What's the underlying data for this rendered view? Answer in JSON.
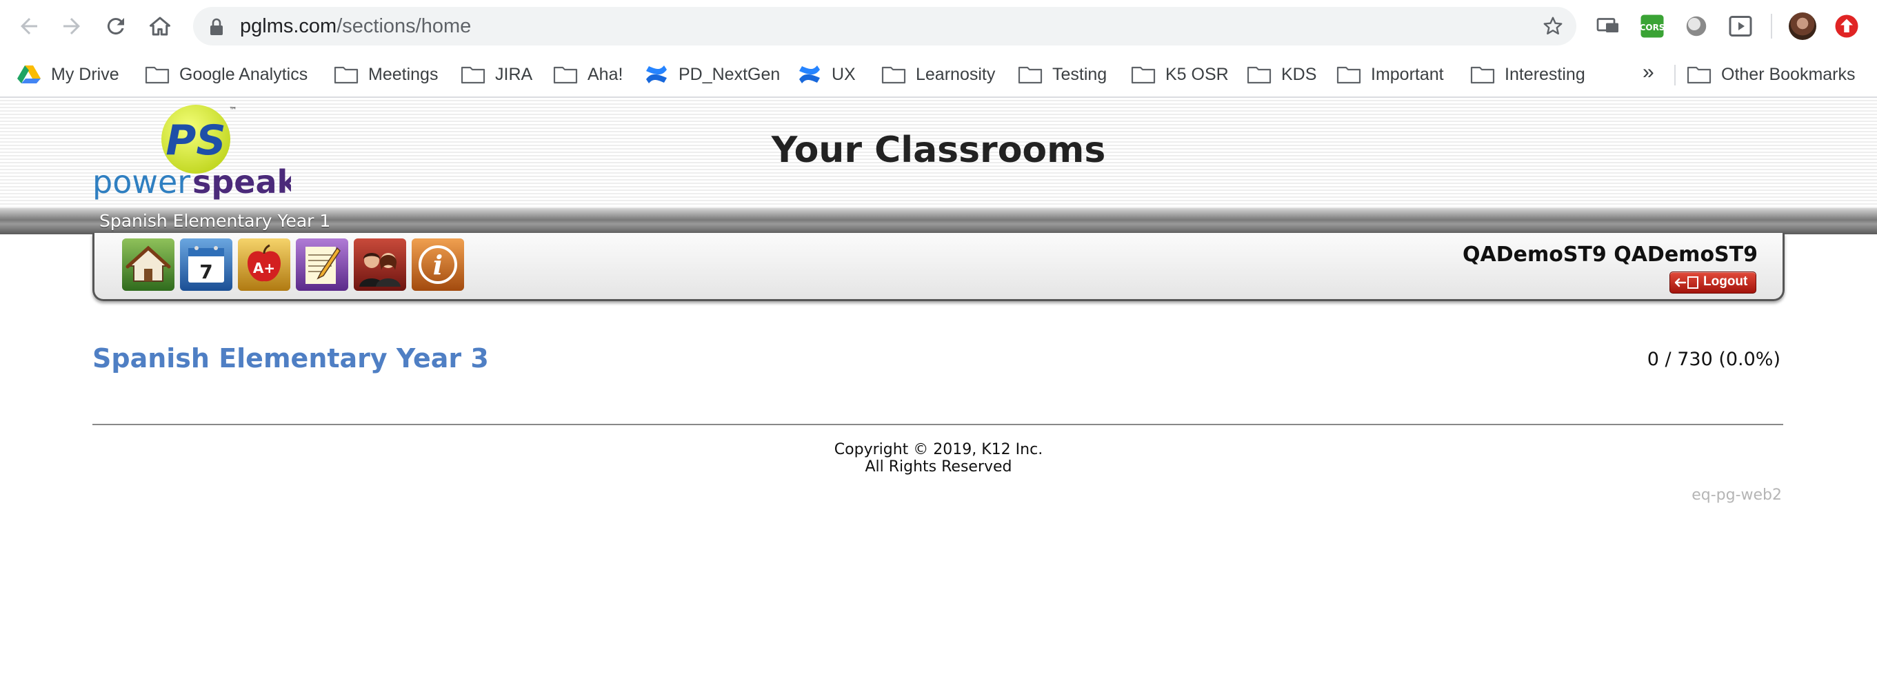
{
  "browser": {
    "url_domain": "pglms.com",
    "url_path": "/sections/home",
    "bookmarks": [
      {
        "label": "My Drive",
        "icon": "google-drive-icon"
      },
      {
        "label": "Google Analytics",
        "icon": "folder-icon"
      },
      {
        "label": "Meetings",
        "icon": "folder-icon"
      },
      {
        "label": "JIRA",
        "icon": "folder-icon"
      },
      {
        "label": "Aha!",
        "icon": "folder-icon"
      },
      {
        "label": "PD_NextGen",
        "icon": "confluence-icon"
      },
      {
        "label": "UX",
        "icon": "confluence-icon"
      },
      {
        "label": "Learnosity",
        "icon": "folder-icon"
      },
      {
        "label": "Testing",
        "icon": "folder-icon"
      },
      {
        "label": "K5 OSR",
        "icon": "folder-icon"
      },
      {
        "label": "KDS",
        "icon": "folder-icon"
      },
      {
        "label": "Important",
        "icon": "folder-icon"
      },
      {
        "label": "Interesting",
        "icon": "folder-icon"
      }
    ],
    "more_label": "»",
    "other_bookmarks": "Other Bookmarks",
    "extensions": [
      "cast-icon",
      "cors-icon",
      "circle-extension-icon",
      "video-extension-icon",
      "upload-extension-icon"
    ]
  },
  "header": {
    "title": "Your Classrooms",
    "logo_text_power": "power",
    "logo_text_speak": "speak",
    "logo_monogram": "PS",
    "logo_tm": "™",
    "course_strip_label": "Spanish Elementary Year 1"
  },
  "nav": {
    "tiles": [
      "home-icon",
      "calendar-icon",
      "grades-icon",
      "assignments-icon",
      "teachers-icon",
      "info-icon"
    ],
    "calendar_day": "7",
    "grades_label": "A+",
    "user_name": "QADemoST9 QADemoST9",
    "logout_label": "Logout"
  },
  "classroom": {
    "name": "Spanish Elementary Year 3",
    "progress": "0 / 730 (0.0%)"
  },
  "footer": {
    "copyright_line1": "Copyright © 2019, K12 Inc.",
    "copyright_line2": "All Rights Reserved",
    "server_id": "eq-pg-web2"
  },
  "colors": {
    "link": "#4f7fc4",
    "logo_power": "#2f7fc1",
    "logo_speak": "#4b2a7a",
    "logo_disc": "#d9ec3a",
    "logout": "#c32417"
  }
}
